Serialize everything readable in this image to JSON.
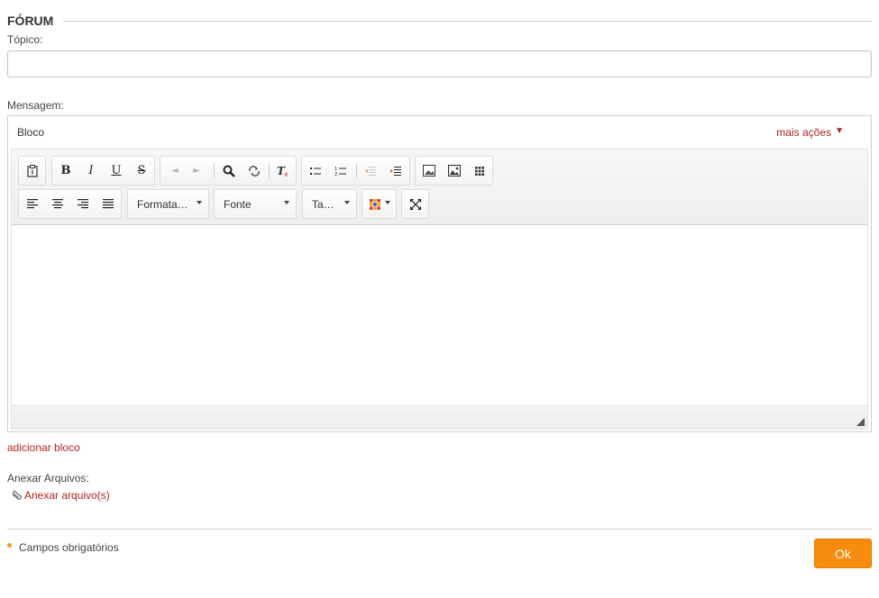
{
  "section": {
    "legend": "FÓRUM"
  },
  "topic": {
    "label": "Tópico:",
    "value": ""
  },
  "message": {
    "label": "Mensagem:",
    "block_title": "Bloco",
    "more_actions": "mais ações",
    "more_arrow": "▼",
    "toolbar": {
      "bold": "B",
      "italic": "I",
      "underline": "U",
      "strike": "S",
      "undo": "◄",
      "redo": "►",
      "format_combo": "Formata…",
      "font_combo": "Fonte",
      "size_combo": "Ta…"
    },
    "content": ""
  },
  "add_block": "adicionar bloco",
  "attach": {
    "label": "Anexar Arquivos:",
    "link": "Anexar arquivo(s)"
  },
  "footer": {
    "required_note": "Campos obrigatórios",
    "ok_label": "Ok"
  },
  "colors": {
    "accent": "#f98c0e",
    "link": "#b22222",
    "required": "#f0a020"
  }
}
